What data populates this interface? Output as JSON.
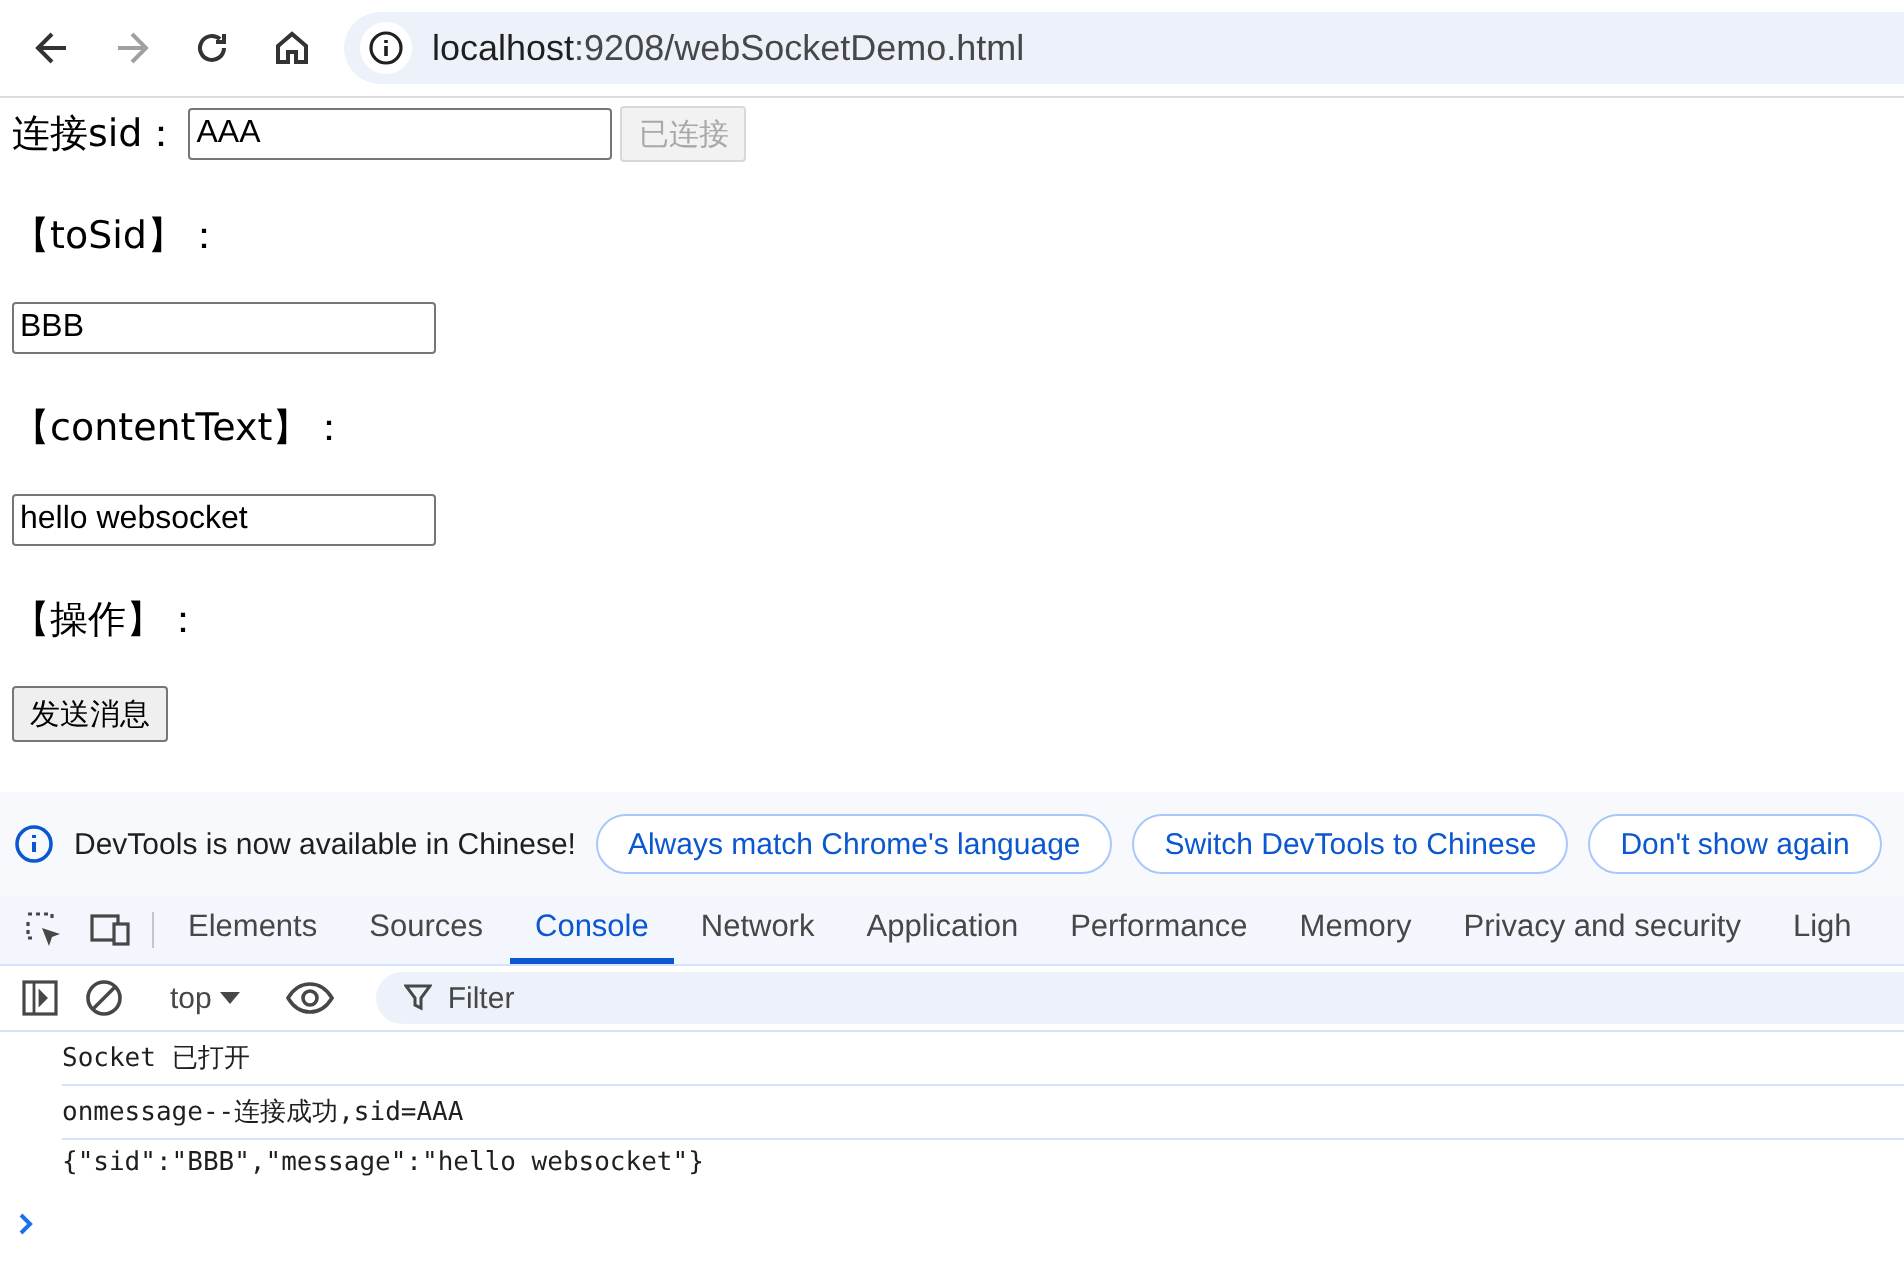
{
  "browser": {
    "nav": [
      {
        "kind": "back",
        "disabled": false
      },
      {
        "kind": "forward",
        "disabled": true
      },
      {
        "kind": "reload",
        "disabled": false
      },
      {
        "kind": "home",
        "disabled": false
      }
    ],
    "url_host": "localhost",
    "url_rest": ":9208/webSocketDemo.html"
  },
  "page": {
    "connect": {
      "label": "连接sid：",
      "value": "AAA",
      "button": {
        "label": "已连接",
        "disabled": true
      }
    },
    "fields": [
      {
        "label": "【toSid】：",
        "value": "BBB"
      },
      {
        "label": "【contentText】：",
        "value": "hello websocket"
      }
    ],
    "action_label": "【操作】：",
    "send_button": "发送消息"
  },
  "devtools": {
    "infobar": {
      "message": "DevTools is now available in Chinese!",
      "buttons": [
        "Always match Chrome's language",
        "Switch DevTools to Chinese",
        "Don't show again"
      ]
    },
    "tabs": [
      {
        "label": "Elements",
        "selected": false
      },
      {
        "label": "Sources",
        "selected": false
      },
      {
        "label": "Console",
        "selected": true
      },
      {
        "label": "Network",
        "selected": false
      },
      {
        "label": "Application",
        "selected": false
      },
      {
        "label": "Performance",
        "selected": false
      },
      {
        "label": "Memory",
        "selected": false
      },
      {
        "label": "Privacy and security",
        "selected": false
      },
      {
        "label": "Ligh",
        "selected": false
      }
    ],
    "context": "top",
    "filter_placeholder": "Filter",
    "messages": [
      "Socket 已打开",
      "onmessage--连接成功,sid=AAA",
      "{\"sid\":\"BBB\",\"message\":\"hello websocket\"}"
    ]
  }
}
